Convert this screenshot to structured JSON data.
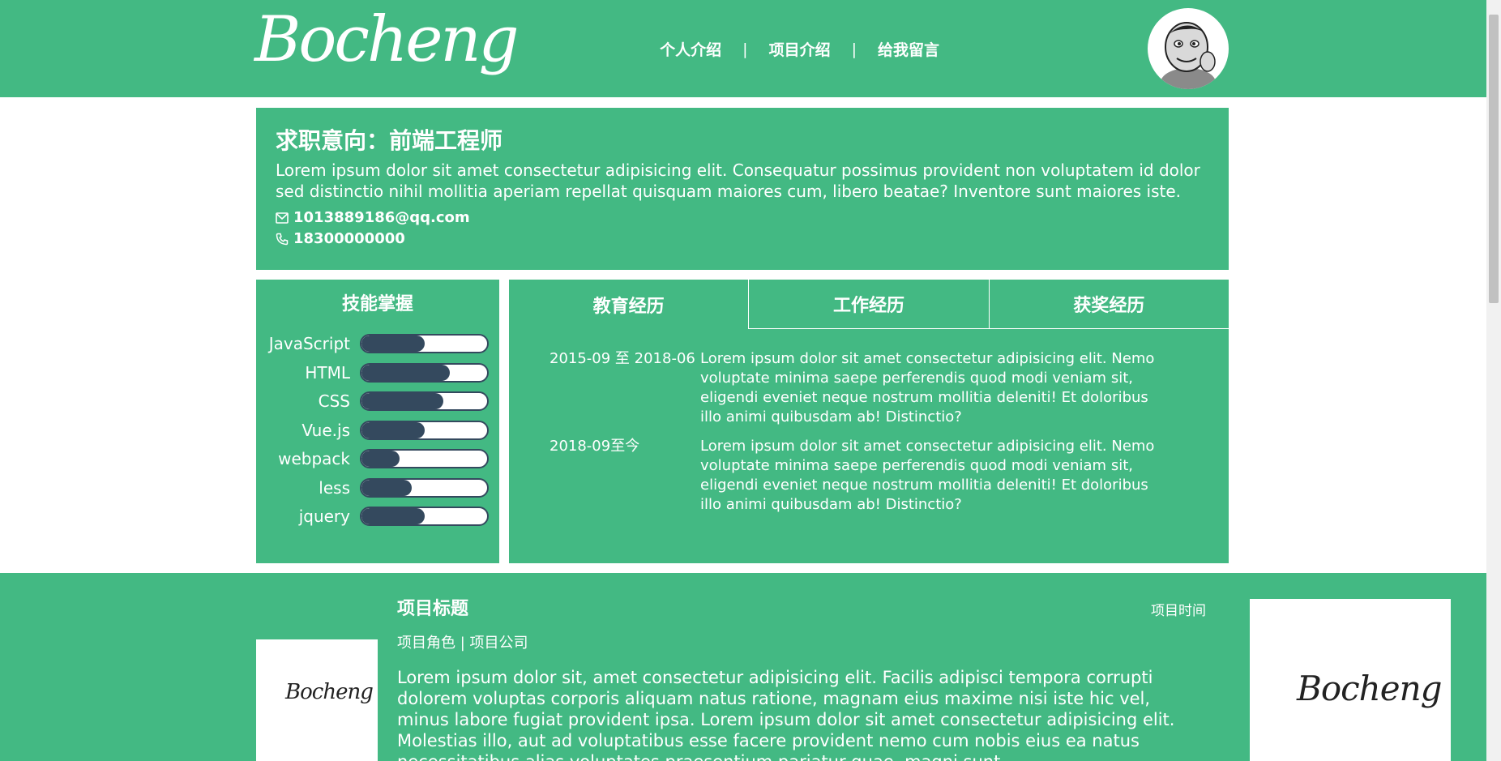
{
  "header": {
    "logo_text": "Bocheng",
    "nav": [
      "个人介绍",
      "项目介绍",
      "给我留言"
    ],
    "nav_separator": "|"
  },
  "intro": {
    "title": "求职意向：前端工程师",
    "description": "Lorem ipsum dolor sit amet consectetur adipisicing elit. Consequatur possimus provident non voluptatem id dolor sed distinctio nihil mollitia aperiam repellat quisquam maiores cum, libero beatae? Inventore sunt maiores iste.",
    "email": "1013889186@qq.com",
    "phone": "18300000000"
  },
  "skills": {
    "title": "技能掌握",
    "items": [
      {
        "name": "JavaScript",
        "level": 0.5
      },
      {
        "name": "HTML",
        "level": 0.7
      },
      {
        "name": "CSS",
        "level": 0.65
      },
      {
        "name": "Vue.js",
        "level": 0.5
      },
      {
        "name": "webpack",
        "level": 0.3
      },
      {
        "name": "less",
        "level": 0.4
      },
      {
        "name": "jquery",
        "level": 0.5
      }
    ]
  },
  "experience": {
    "tabs": [
      "教育经历",
      "工作经历",
      "获奖经历"
    ],
    "active_tab": "教育经历",
    "items": [
      {
        "date": "2015-09 至 2018-06",
        "text": "Lorem ipsum dolor sit amet consectetur adipisicing elit. Nemo voluptate minima saepe perferendis quod modi veniam sit, eligendi eveniet neque nostrum mollitia deleniti! Et doloribus illo animi quibusdam ab! Distinctio?"
      },
      {
        "date": "2018-09至今",
        "text": "Lorem ipsum dolor sit amet consectetur adipisicing elit. Nemo voluptate minima saepe perferendis quod modi veniam sit, eligendi eveniet neque nostrum mollitia deleniti! Et doloribus illo animi quibusdam ab! Distinctio?"
      }
    ]
  },
  "project": {
    "title": "项目标题",
    "time": "项目时间",
    "meta": "项目角色 | 项目公司",
    "description": "Lorem ipsum dolor sit, amet consectetur adipisicing elit. Facilis adipisci tempora corrupti dolorem voluptas corporis aliquam natus ratione, magnam eius maxime nisi iste hic vel, minus labore fugiat provident ipsa. Lorem ipsum dolor sit amet consectetur adipisicing elit. Molestias illo, aut ad voluptatibus esse facere provident nemo cum nobis eius ea natus necessitatibus alias voluptates praesentium pariatur quae, magni sunt.",
    "thumb_logo_text": "Bocheng"
  },
  "colors": {
    "primary": "#43b983",
    "bar": "#34495e",
    "text": "#ffffff"
  }
}
